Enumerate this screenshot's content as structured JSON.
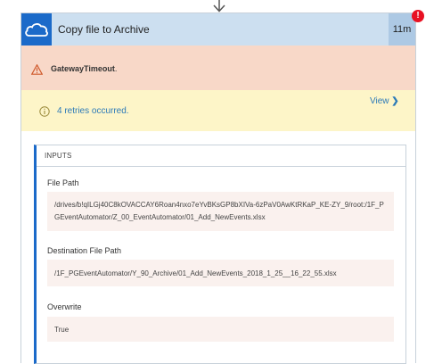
{
  "step": {
    "title": "Copy file to Archive",
    "duration": "11m",
    "error_badge": "!",
    "icon": "cloud-icon"
  },
  "error": {
    "code": "GatewayTimeout",
    "suffix": ".",
    "icon": "warning-icon"
  },
  "retries": {
    "text": "4 retries occurred.",
    "view_label": "View",
    "chevron": "❯",
    "icon": "info-icon"
  },
  "inputs": {
    "section_label": "INPUTS",
    "fields": [
      {
        "label": "File Path",
        "value": "/drives/b!qILGj40C8kOVACCAY6Roan4nxo7eYvBKsGP8bXIVa-6zPaV0AwKtRKaP_KE-ZY_9/root:/1F_PGEventAutomator/Z_00_EventAutomator/01_Add_NewEvents.xlsx"
      },
      {
        "label": "Destination File Path",
        "value": "/1F_PGEventAutomator/Y_90_Archive/01_Add_NewEvents_2018_1_25__16_22_55.xlsx"
      },
      {
        "label": "Overwrite",
        "value": "True"
      }
    ]
  },
  "colors": {
    "header_bg": "#ccdff0",
    "icon_bg": "#1b6ac9",
    "error_bg": "#f8d8c8",
    "retry_bg": "#fdf5c8",
    "link": "#2c7ab8",
    "badge": "#e81123"
  }
}
